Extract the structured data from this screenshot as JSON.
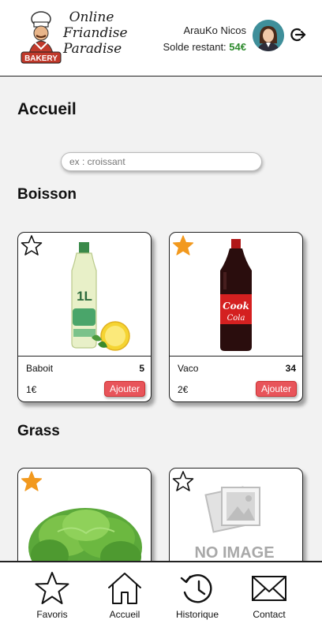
{
  "header": {
    "logo": {
      "brand_line1": "Online",
      "brand_line2": "Friandise",
      "brand_line3": "Paradise",
      "badge_text": "BAKERY",
      "icon": "chef-logo-icon"
    },
    "user": {
      "name": "ArauKo Nicos",
      "balance_label": "Solde restant:",
      "balance_value": "54€",
      "avatar_icon": "user-avatar-icon",
      "logout_icon": "logout-icon"
    }
  },
  "main": {
    "title": "Accueil",
    "search": {
      "placeholder": "ex : croissant",
      "value": ""
    },
    "sections": [
      {
        "title": "Boisson",
        "products": [
          {
            "name": "Baboit",
            "quantity": "5",
            "price": "1€",
            "button": "Ajouter",
            "favorite": false,
            "image": "water-bottle-image"
          },
          {
            "name": "Vaco",
            "quantity": "34",
            "price": "2€",
            "button": "Ajouter",
            "favorite": true,
            "image": "cola-bottle-image",
            "bottle_label_1": "Cook",
            "bottle_label_2": "Cola"
          }
        ]
      },
      {
        "title": "Grass",
        "products": [
          {
            "favorite": true,
            "image": "lettuce-image"
          },
          {
            "favorite": false,
            "image": "no-image-placeholder",
            "image_text": "NO IMAGE"
          }
        ]
      }
    ]
  },
  "bottom_nav": [
    {
      "label": "Favoris",
      "icon": "star-icon"
    },
    {
      "label": "Accueil",
      "icon": "home-icon"
    },
    {
      "label": "Historique",
      "icon": "history-icon"
    },
    {
      "label": "Contact",
      "icon": "mail-icon"
    }
  ],
  "colors": {
    "accent_button": "#e8545a",
    "balance": "#2e8b2e",
    "star_active": "#f2991e"
  }
}
